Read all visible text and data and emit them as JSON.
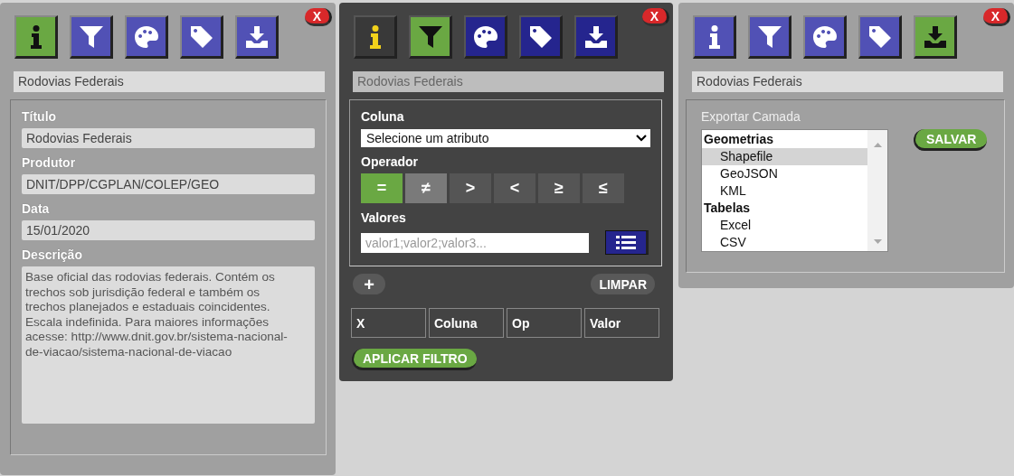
{
  "panels": [
    {
      "kind": "info",
      "dark": false,
      "close": "X",
      "tools": [
        {
          "kind": "info",
          "selected": true
        },
        {
          "kind": "filter",
          "selected": false
        },
        {
          "kind": "palette",
          "selected": false
        },
        {
          "kind": "tag",
          "selected": false
        },
        {
          "kind": "download",
          "selected": false
        }
      ],
      "layer_name": "Rodovias Federais",
      "fields": [
        {
          "label": "Título",
          "value": "Rodovias Federais"
        },
        {
          "label": "Produtor",
          "value": "DNIT/DPP/CGPLAN/COLEP/GEO"
        },
        {
          "label": "Data",
          "value": "15/01/2020"
        }
      ],
      "description": {
        "label": "Descrição",
        "value": "Base oficial das rodovias federais. Contém os trechos sob jurisdição federal e também os trechos planejados e estaduais coincidentes. Escala indefinida. Para maiores informações acesse: http://www.dnit.gov.br/sistema-nacional-de-viacao/sistema-nacional-de-viacao"
      }
    },
    {
      "kind": "filter",
      "dark": true,
      "close": "X",
      "tools": [
        {
          "kind": "info",
          "selected": false
        },
        {
          "kind": "filter",
          "selected": true
        },
        {
          "kind": "palette",
          "selected": false
        },
        {
          "kind": "tag",
          "selected": false
        },
        {
          "kind": "download",
          "selected": false
        }
      ],
      "layer_name": "Rodovias Federais",
      "column_label": "Coluna",
      "column_select": "Selecione um atributo",
      "operator_label": "Operador",
      "operators": [
        {
          "symbol": "=",
          "selected": true,
          "hovered": false
        },
        {
          "symbol": "≠",
          "selected": false,
          "hovered": true
        },
        {
          "symbol": ">",
          "selected": false,
          "hovered": false
        },
        {
          "symbol": "<",
          "selected": false,
          "hovered": false
        },
        {
          "symbol": "≥",
          "selected": false,
          "hovered": false
        },
        {
          "symbol": "≤",
          "selected": false,
          "hovered": false
        }
      ],
      "values_label": "Valores",
      "values_placeholder": "valor1;valor2;valor3...",
      "add_button": "+",
      "clear_button": "LIMPAR",
      "table": {
        "columns": [
          "X",
          "Coluna",
          "Op",
          "Valor"
        ]
      },
      "apply_button": "APLICAR FILTRO"
    },
    {
      "kind": "export",
      "dark": false,
      "close": "X",
      "tools": [
        {
          "kind": "info",
          "selected": false
        },
        {
          "kind": "filter",
          "selected": false
        },
        {
          "kind": "palette",
          "selected": false
        },
        {
          "kind": "tag",
          "selected": false
        },
        {
          "kind": "download",
          "selected": true
        }
      ],
      "layer_name": "Rodovias Federais",
      "export_label": "Exportar Camada",
      "groups": [
        {
          "label": "Geometrias",
          "options": [
            {
              "label": "Shapefile",
              "selected": true
            },
            {
              "label": "GeoJSON",
              "selected": false
            },
            {
              "label": "KML",
              "selected": false
            }
          ]
        },
        {
          "label": "Tabelas",
          "options": [
            {
              "label": "Excel",
              "selected": false
            },
            {
              "label": "CSV",
              "selected": false
            }
          ]
        }
      ],
      "save_button": "SALVAR"
    }
  ]
}
